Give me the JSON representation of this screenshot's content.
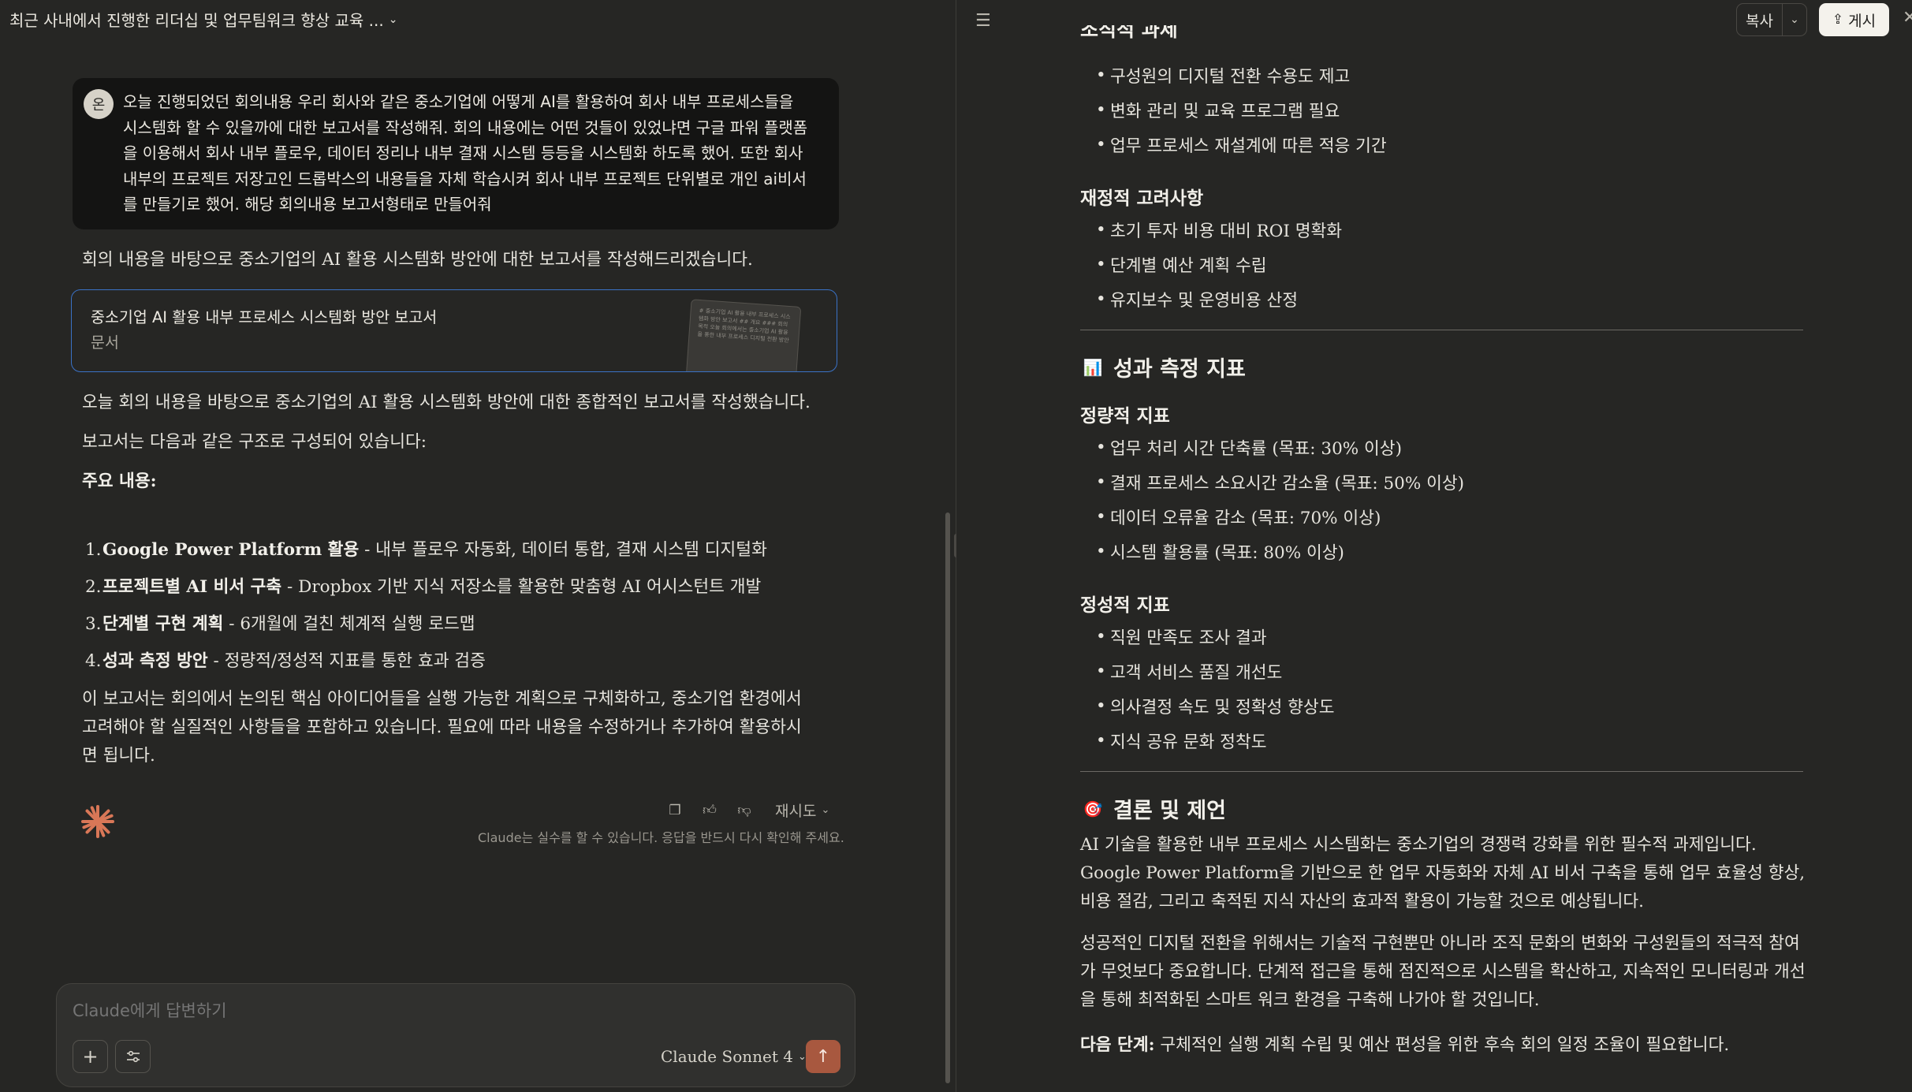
{
  "conversation": {
    "title": "최근 사내에서 진행한 리더십 및 업무팀워크 향상 교육 ...",
    "user_avatar": "온",
    "user_message": "오늘 진행되었던 회의내용 우리 회사와 같은 중소기업에 어떻게 AI를 활용하여 회사 내부 프로세스들을 시스템화 할 수 있을까에 대한 보고서를 작성해줘. 회의 내용에는 어떤 것들이 있었냐면 구글 파워 플랫폼을 이용해서 회사 내부 플로우, 데이터 정리나 내부 결재 시스템 등등을 시스템화 하도록 했어. 또한 회사 내부의 프로젝트 저장고인 드롭박스의 내용들을 자체 학습시켜 회사 내부 프로젝트 단위별로 개인 ai비서를 만들기로 했어. 해당 회의내용 보고서형태로 만들어줘",
    "assistant_intro": "회의 내용을 바탕으로 중소기업의 AI 활용 시스템화 방안에 대한 보고서를 작성해드리겠습니다.",
    "artifact": {
      "title": "중소기업 AI 활용 내부 프로세스 시스템화 방안 보고서",
      "type": "문서",
      "thumb_text": "# 중소기업 AI 활용 내부 프로세스 시스템화 방안 보고서 ## 개요 ### 회의 목적 오늘 회의에서는 중소기업 AI 활용을 통한 내부 프로세스 디지털 전환 방안"
    },
    "summary_p1": "오늘 회의 내용을 바탕으로 중소기업의 AI 활용 시스템화 방안에 대한 종합적인 보고서를 작성했습니다.",
    "summary_p2": "보고서는 다음과 같은 구조로 구성되어 있습니다:",
    "summary_heading": "주요 내용:",
    "summary_items": [
      {
        "num": "1.",
        "bold": "Google Power Platform 활용",
        "rest": " - 내부 플로우 자동화, 데이터 통합, 결재 시스템 디지털화"
      },
      {
        "num": "2.",
        "bold": "프로젝트별 AI 비서 구축",
        "rest": " - Dropbox 기반 지식 저장소를 활용한 맞춤형 AI 어시스턴트 개발"
      },
      {
        "num": "3.",
        "bold": "단계별 구현 계획",
        "rest": " - 6개월에 걸친 체계적 실행 로드맵"
      },
      {
        "num": "4.",
        "bold": "성과 측정 방안",
        "rest": " - 정량적/정성적 지표를 통한 효과 검증"
      }
    ],
    "summary_closing": "이 보고서는 회의에서 논의된 핵심 아이디어들을 실행 가능한 계획으로 구체화하고, 중소기업 환경에서 고려해야 할 실질적인 사항들을 포함하고 있습니다. 필요에 따라 내용을 수정하거나 추가하여 활용하시면 됩니다.",
    "retry_label": "재시도",
    "disclaimer": "Claude는 실수를 할 수 있습니다. 응답을 반드시 다시 확인해 주세요."
  },
  "composer": {
    "placeholder": "Claude에게 답변하기",
    "model": "Claude Sonnet 4"
  },
  "artifact_panel": {
    "copy_label": "복사",
    "publish_label": "게시",
    "cut_heading": "조직적 과제",
    "org_items": [
      "구성원의 디지털 전환 수용도 제고",
      "변화 관리 및 교육 프로그램 필요",
      "업무 프로세스 재설계에 따른 적응 기간"
    ],
    "finance_heading": "재정적 고려사항",
    "finance_items": [
      "초기 투자 비용 대비 ROI 명확화",
      "단계별 예산 계획 수립",
      "유지보수 및 운영비용 산정"
    ],
    "kpi_heading": "성과 측정 지표",
    "kpi_emoji": "📊",
    "quant_heading": "정량적 지표",
    "quant_items": [
      "업무 처리 시간 단축률 (목표: 30% 이상)",
      "결재 프로세스 소요시간 감소율 (목표: 50% 이상)",
      "데이터 오류율 감소 (목표: 70% 이상)",
      "시스템 활용률 (목표: 80% 이상)"
    ],
    "qual_heading": "정성적 지표",
    "qual_items": [
      "직원 만족도 조사 결과",
      "고객 서비스 품질 개선도",
      "의사결정 속도 및 정확성 향상도",
      "지식 공유 문화 정착도"
    ],
    "conclusion_heading": "결론 및 제언",
    "conclusion_emoji": "🎯",
    "conclusion_p1": "AI 기술을 활용한 내부 프로세스 시스템화는 중소기업의 경쟁력 강화를 위한 필수적 과제입니다. Google Power Platform을 기반으로 한 업무 자동화와 자체 AI 비서 구축을 통해 업무 효율성 향상, 비용 절감, 그리고 축적된 지식 자산의 효과적 활용이 가능할 것으로 예상됩니다.",
    "conclusion_p2": "성공적인 디지털 전환을 위해서는 기술적 구현뿐만 아니라 조직 문화의 변화와 구성원들의 적극적 참여가 무엇보다 중요합니다. 단계적 접근을 통해 점진적으로 시스템을 확산하고, 지속적인 모니터링과 개선을 통해 최적화된 스마트 워크 환경을 구축해 나가야 할 것입니다.",
    "next_label": "다음 단계:",
    "next_text": " 구체적인 실행 계획 수립 및 예산 편성을 위한 후속 회의 일정 조율이 필요합니다."
  }
}
